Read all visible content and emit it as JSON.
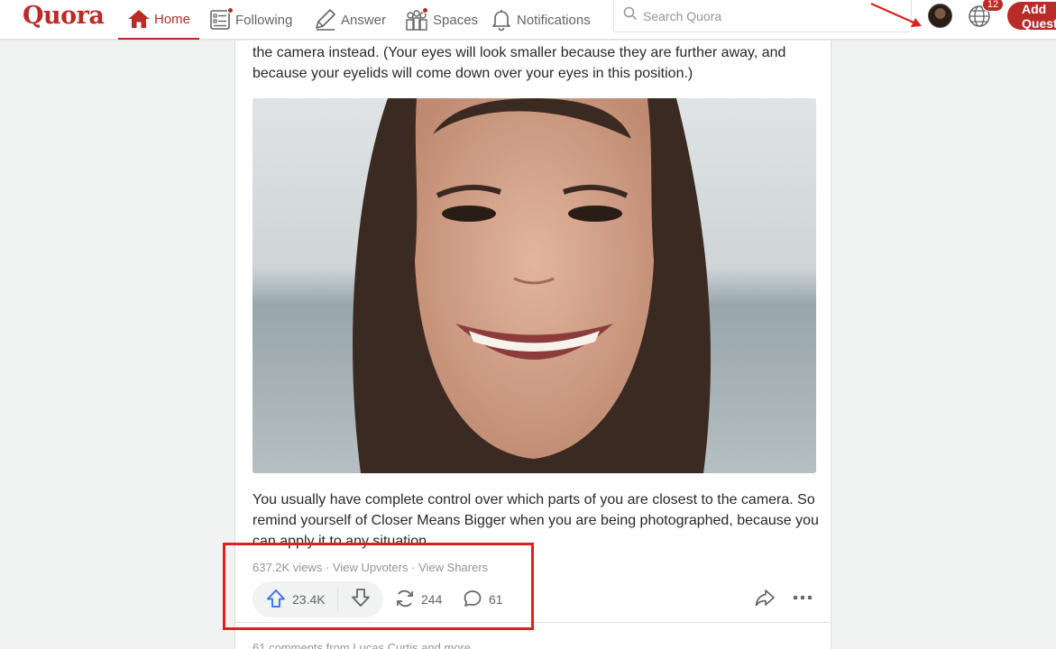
{
  "header": {
    "logo": "Quora",
    "nav": {
      "home": "Home",
      "following": "Following",
      "answer": "Answer",
      "spaces": "Spaces",
      "notifications": "Notifications"
    },
    "search_placeholder": "Search Quora",
    "language_badge": "12",
    "add_question_label": "Add Question"
  },
  "answer": {
    "paragraph_1": "the camera instead. (Your eyes will look smaller because they are further away, and because your eyelids will come down over your eyes in this position.)",
    "paragraph_2": "You usually have complete control over which parts of you are closest to the camera. So remind yourself of Closer Means Bigger when you are being photographed, because you can apply it to any situation.",
    "views": "637.2K views",
    "separator": "·",
    "view_upvoters": "View Upvoters",
    "view_sharers": "View Sharers",
    "upvotes": "23.4K",
    "shares": "244",
    "comments": "61",
    "comments_teaser": "61 comments from Lucas Curtis and more"
  },
  "colors": {
    "brand": "#b92b27",
    "upvote_blue": "#2e69ff",
    "annotation_red": "#e01f1f"
  }
}
